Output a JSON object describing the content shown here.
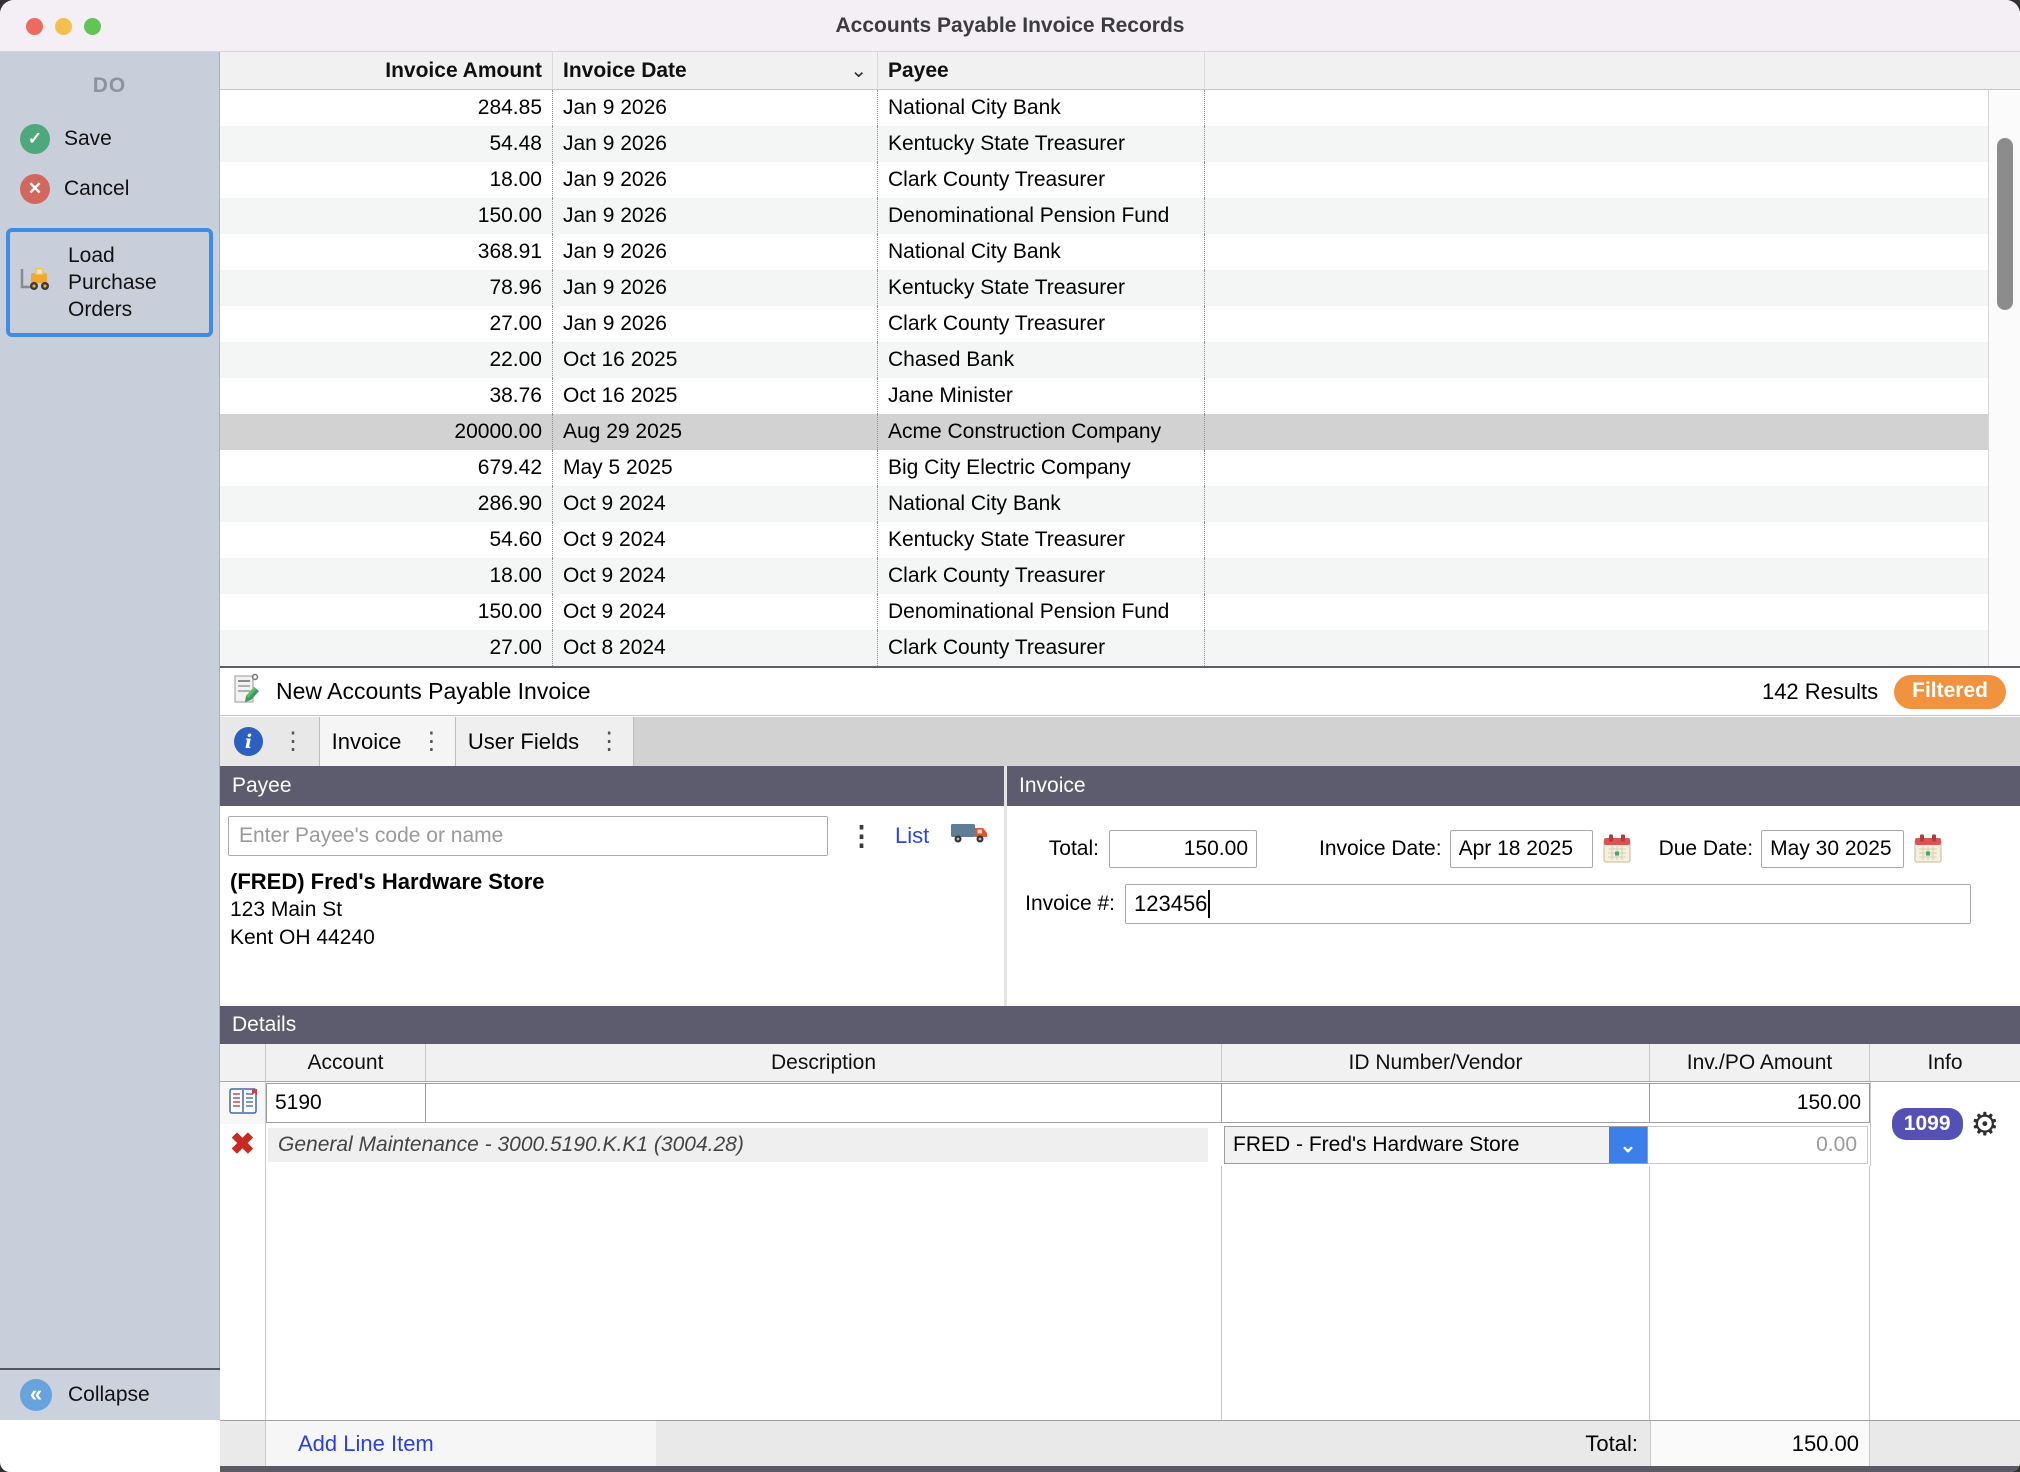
{
  "window": {
    "title": "Accounts Payable Invoice Records"
  },
  "sidebar": {
    "header": "DO",
    "save_label": "Save",
    "cancel_label": "Cancel",
    "load_po_line1": "Load",
    "load_po_line2": "Purchase",
    "load_po_line3": "Orders",
    "collapse_label": "Collapse"
  },
  "records": {
    "columns": {
      "amount": "Invoice Amount",
      "date": "Invoice Date",
      "payee": "Payee"
    },
    "rows": [
      {
        "amount": "284.85",
        "date": "Jan 9 2026",
        "payee": "National City Bank"
      },
      {
        "amount": "54.48",
        "date": "Jan 9 2026",
        "payee": "Kentucky State Treasurer"
      },
      {
        "amount": "18.00",
        "date": "Jan 9 2026",
        "payee": "Clark County Treasurer"
      },
      {
        "amount": "150.00",
        "date": "Jan 9 2026",
        "payee": "Denominational Pension Fund"
      },
      {
        "amount": "368.91",
        "date": "Jan 9 2026",
        "payee": "National City Bank"
      },
      {
        "amount": "78.96",
        "date": "Jan 9 2026",
        "payee": "Kentucky State Treasurer"
      },
      {
        "amount": "27.00",
        "date": "Jan 9 2026",
        "payee": "Clark County Treasurer"
      },
      {
        "amount": "22.00",
        "date": "Oct 16 2025",
        "payee": "Chased Bank"
      },
      {
        "amount": "38.76",
        "date": "Oct 16 2025",
        "payee": "Jane Minister"
      },
      {
        "amount": "20000.00",
        "date": "Aug 29 2025",
        "payee": "Acme Construction Company",
        "selected": true
      },
      {
        "amount": "679.42",
        "date": "May 5 2025",
        "payee": "Big City Electric Company"
      },
      {
        "amount": "286.90",
        "date": "Oct 9 2024",
        "payee": "National City Bank"
      },
      {
        "amount": "54.60",
        "date": "Oct 9 2024",
        "payee": "Kentucky State Treasurer"
      },
      {
        "amount": "18.00",
        "date": "Oct 9 2024",
        "payee": "Clark County Treasurer"
      },
      {
        "amount": "150.00",
        "date": "Oct 9 2024",
        "payee": "Denominational Pension Fund"
      },
      {
        "amount": "27.00",
        "date": "Oct 8 2024",
        "payee": "Clark County Treasurer"
      }
    ]
  },
  "results_bar": {
    "title": "New Accounts Payable Invoice",
    "count": "142 Results",
    "badge": "Filtered"
  },
  "tabs": {
    "invoice": "Invoice",
    "user_fields": "User Fields"
  },
  "payee_panel": {
    "header": "Payee",
    "placeholder": "Enter Payee's code or name",
    "list_link": "List",
    "name": "(FRED) Fred's Hardware Store",
    "address_line1": "123 Main St",
    "address_line2": "Kent OH 44240"
  },
  "invoice_panel": {
    "header": "Invoice",
    "total_label": "Total:",
    "total_value": "150.00",
    "invoice_date_label": "Invoice Date:",
    "invoice_date_value": "Apr 18 2025",
    "due_date_label": "Due Date:",
    "due_date_value": "May 30 2025",
    "invoice_number_label": "Invoice #:",
    "invoice_number_value": "123456"
  },
  "details": {
    "header": "Details",
    "columns": {
      "account": "Account",
      "description": "Description",
      "vendor": "ID Number/Vendor",
      "amount": "Inv./PO Amount",
      "info": "Info"
    },
    "line_item": {
      "account": "5190",
      "description": "",
      "amount": "150.00",
      "info_badge": "1099",
      "expense_summary": "General Maintenance - 3000.5190.K.K1 (3004.28)",
      "vendor": "FRED - Fred's Hardware Store",
      "vendor_amount": "0.00"
    },
    "add_line_label": "Add Line Item",
    "total_label": "Total:",
    "total_value": "150.00"
  },
  "icons": {
    "glyphs": {
      "check": "✓",
      "cross": "✕",
      "kebab": "⋮",
      "sort_chevron": "⌄",
      "dropdown_chevron": "⌄",
      "collapse_chevrons": "«",
      "info": "i",
      "gear": "⚙",
      "delete": "✖"
    }
  },
  "colors": {
    "highlight_blue": "#3E8BE8",
    "link_blue": "#2B46E0",
    "filtered_orange": "#F0923E",
    "badge_indigo": "#5450B4",
    "header_slate": "#5D5C6F",
    "save_green": "#4EA87C",
    "cancel_red": "#D2685D",
    "titlebar": "#F4EEF5",
    "sidebar_bg": "#C9CFDA",
    "selected_row": "#D2D2D2"
  }
}
